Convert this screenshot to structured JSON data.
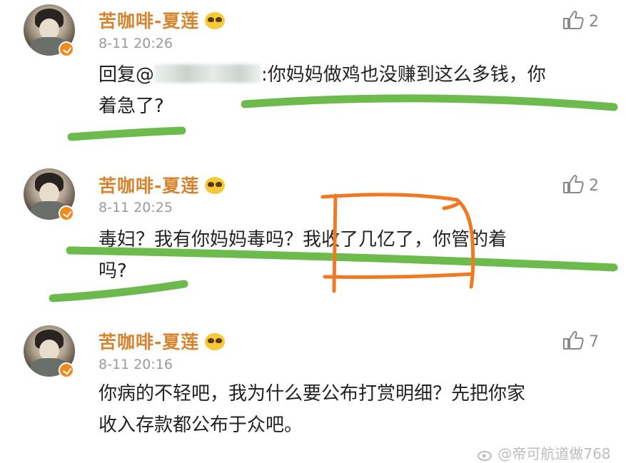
{
  "comments": [
    {
      "username": "苦咖啡-夏莲",
      "time": "8-11 20:26",
      "likes": "2",
      "reply_prefix": "回复@",
      "text_line1": ":你妈妈做鸡也没赚到这么多钱，你",
      "text_line2": "着急了?"
    },
    {
      "username": "苦咖啡-夏莲",
      "time": "8-11 20:25",
      "likes": "2",
      "text_line1": "毒妇？我有你妈妈毒吗？我收了几亿了，你管的着",
      "text_line2": "吗?"
    },
    {
      "username": "苦咖啡-夏莲",
      "time": "8-11 20:16",
      "likes": "7",
      "text_line1": "你病的不轻吧，我为什么要公布打赏明细？先把你家",
      "text_line2": "收入存款都公布于众吧。"
    }
  ],
  "watermark": "@帝可航道做768",
  "colors": {
    "username": "#d7832d",
    "highlight_green": "#5db33a",
    "highlight_orange": "#f07a24",
    "verified_badge": "#f08a1c"
  },
  "icons": [
    "avatar",
    "verified-badge-icon",
    "emoji-icon",
    "thumb-up-icon",
    "weibo-logo-icon"
  ]
}
